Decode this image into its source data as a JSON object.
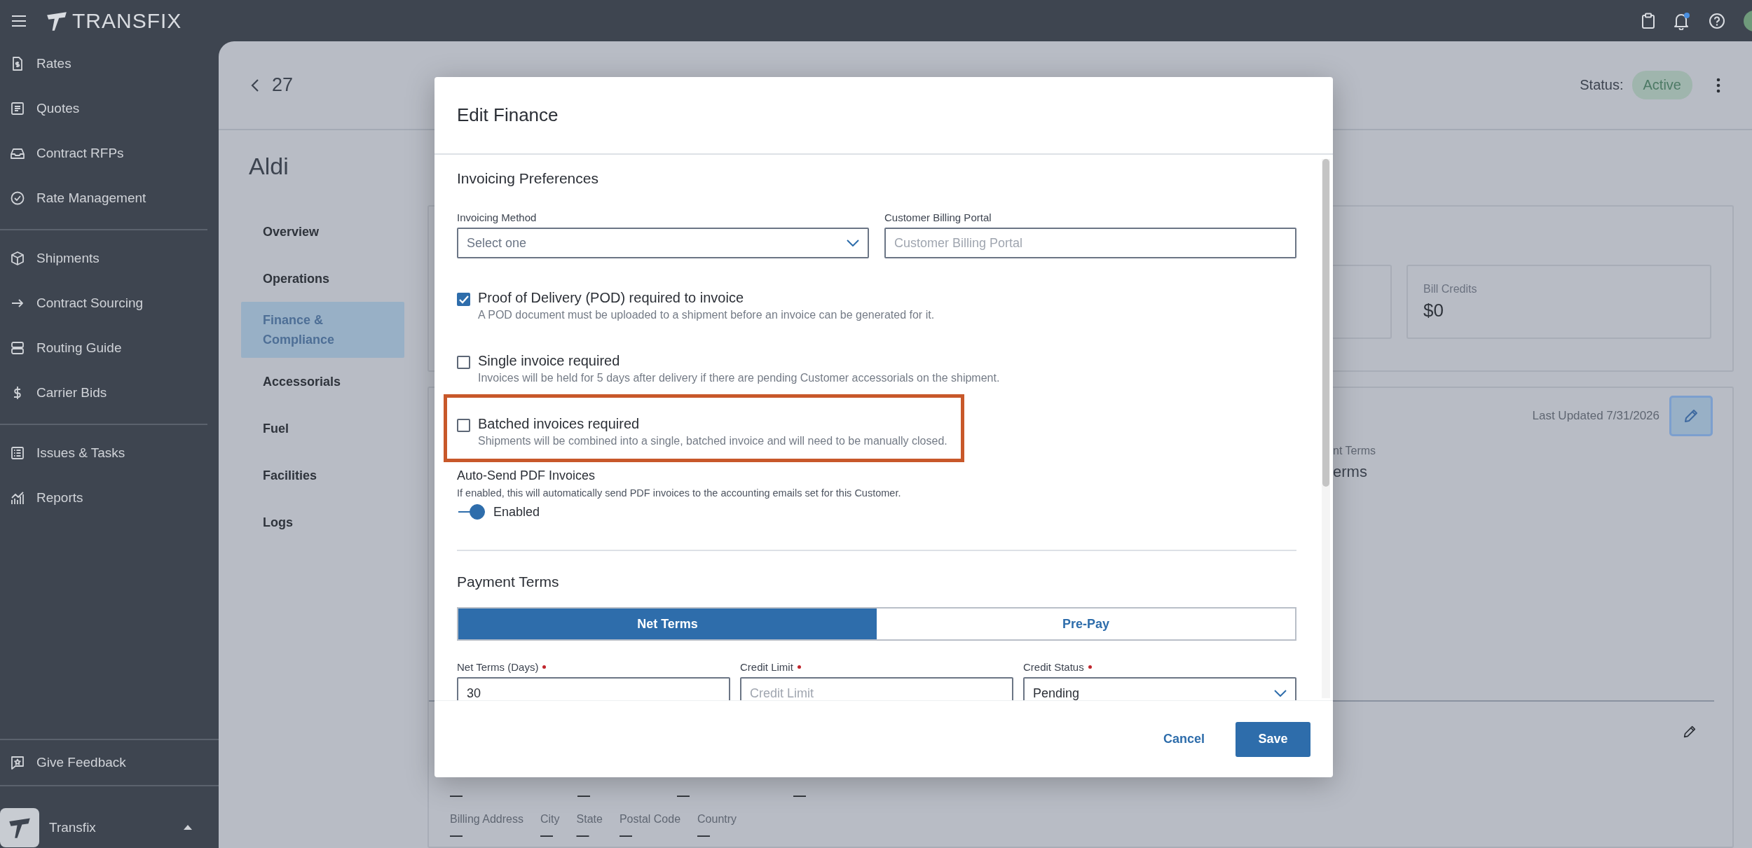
{
  "topbar": {
    "brand": "TRANSFIX"
  },
  "sidebar": {
    "groups": [
      [
        {
          "label": "Rates"
        },
        {
          "label": "Quotes"
        },
        {
          "label": "Contract RFPs"
        },
        {
          "label": "Rate Management"
        }
      ],
      [
        {
          "label": "Shipments"
        },
        {
          "label": "Contract Sourcing"
        },
        {
          "label": "Routing Guide"
        },
        {
          "label": "Carrier Bids"
        }
      ],
      [
        {
          "label": "Issues & Tasks"
        },
        {
          "label": "Reports"
        }
      ]
    ],
    "feedback": "Give Feedback",
    "account": "Transfix"
  },
  "page": {
    "back_label": "27",
    "status_label": "Status:",
    "status": "Active",
    "customer": "Aldi",
    "sections": [
      {
        "label": "Overview",
        "selected": false
      },
      {
        "label": "Operations",
        "selected": false
      },
      {
        "label": "Finance & Compliance",
        "selected": true
      },
      {
        "label": "Accessorials",
        "selected": false
      },
      {
        "label": "Fuel",
        "selected": false
      },
      {
        "label": "Facilities",
        "selected": false
      },
      {
        "label": "Logs",
        "selected": false
      }
    ],
    "summary_cards": [
      {
        "label": "Bill Credits",
        "value": "$0"
      }
    ],
    "detail": {
      "last_updated": "Last Updated 7/31/2026",
      "column_label": "nt Terms",
      "column_value": "erms"
    },
    "dash_row": [
      "—",
      "—",
      "—",
      "—"
    ],
    "billing_fields": [
      {
        "label": "Billing Address",
        "value": "—"
      },
      {
        "label": "City",
        "value": "—"
      },
      {
        "label": "State",
        "value": "—"
      },
      {
        "label": "Postal Code",
        "value": "—"
      },
      {
        "label": "Country",
        "value": "—"
      }
    ]
  },
  "modal": {
    "title": "Edit Finance",
    "section_1": "Invoicing Preferences",
    "top_fields": [
      {
        "label": "Invoicing Method",
        "kind": "select",
        "placeholder": "Select one"
      },
      {
        "label": "Customer Billing Portal",
        "kind": "text",
        "placeholder": "Customer Billing Portal"
      }
    ],
    "options": [
      {
        "title": "Proof of Delivery (POD) required to invoice",
        "description": "A POD document must be uploaded to a shipment before an invoice can be generated for it.",
        "checked": true,
        "highlighted": false
      },
      {
        "title": "Single invoice required",
        "description": "Invoices will be held for 5 days after delivery if there are pending Customer accessorials on the shipment.",
        "checked": false,
        "highlighted": false
      },
      {
        "title": "Batched invoices required",
        "description": "Shipments will be combined into a single, batched invoice and will need to be manually closed.",
        "checked": false,
        "highlighted": true
      }
    ],
    "auto_send": {
      "title": "Auto-Send PDF Invoices",
      "description": "If enabled, this will automatically send PDF invoices to the accounting emails set for this Customer.",
      "label": "Enabled",
      "on": true
    },
    "section_2": "Payment Terms",
    "payment_tabs": [
      {
        "label": "Net Terms",
        "selected": true
      },
      {
        "label": "Pre-Pay",
        "selected": false
      }
    ],
    "term_fields": [
      {
        "label": "Net Terms (Days)",
        "required": true,
        "kind": "text",
        "value": "30"
      },
      {
        "label": "Credit Limit",
        "required": true,
        "kind": "text",
        "placeholder": "Credit Limit"
      },
      {
        "label": "Credit Status",
        "required": true,
        "kind": "select",
        "value": "Pending"
      }
    ],
    "cancel": "Cancel",
    "save": "Save"
  }
}
